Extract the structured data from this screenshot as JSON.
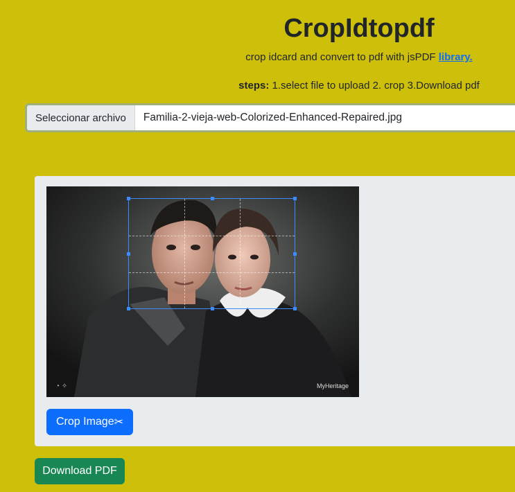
{
  "header": {
    "title": "CropIdtopdf",
    "subtitle_text": "crop idcard and convert to pdf with jsPDF ",
    "subtitle_link": "library.",
    "steps_label": "steps:",
    "steps_text": " 1.select file to upload 2. crop 3.Download pdf"
  },
  "file_input": {
    "button_label": "Seleccionar archivo",
    "file_name": "Familia-2-vieja-web-Colorized-Enhanced-Repaired.jpg"
  },
  "preview": {
    "watermark": "MyHeritage"
  },
  "actions": {
    "crop_label": "Crop Image",
    "crop_icon": "✂",
    "download_label": "Download PDF"
  },
  "colors": {
    "background": "#cec00a",
    "primary": "#0d6efd",
    "success": "#198754",
    "crop_border": "#3b8cff"
  }
}
